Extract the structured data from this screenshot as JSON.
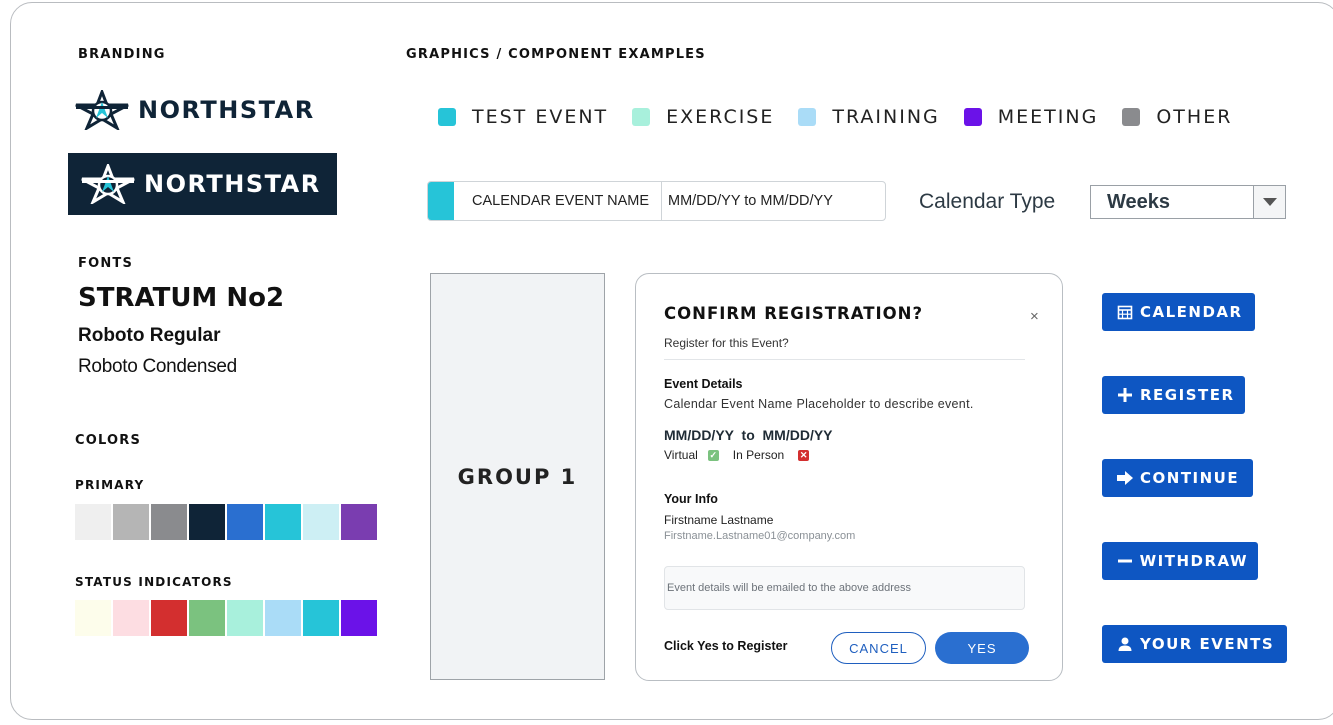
{
  "branding": {
    "heading": "BRANDING",
    "logo_text": "NORTHSTAR",
    "logo_dark_text": "NORTHSTAR"
  },
  "fonts": {
    "heading": "FONTS",
    "stratum": "STRATUM No2",
    "roboto_regular": "Roboto Regular",
    "roboto_condensed": "Roboto Condensed"
  },
  "colors": {
    "heading": "COLORS",
    "primary_label": "PRIMARY",
    "primary": [
      "#efefef",
      "#b5b5b5",
      "#8a8b8e",
      "#0f2437",
      "#2a6fd0",
      "#26c4d8",
      "#cdeff4",
      "#7a3db0"
    ],
    "status_label": "STATUS INDICATORS",
    "status": [
      "#fdfdeb",
      "#fddde2",
      "#d32f2f",
      "#7bc27f",
      "#a8f0dc",
      "#aadcf7",
      "#26c4d8",
      "#6b12e8"
    ]
  },
  "graphics": {
    "heading": "GRAPHICS / COMPONENT EXAMPLES",
    "legend": [
      {
        "label": "TEST EVENT",
        "color": "#26c4d8"
      },
      {
        "label": "EXERCISE",
        "color": "#a8f0dc"
      },
      {
        "label": "TRAINING",
        "color": "#aadcf7"
      },
      {
        "label": "MEETING",
        "color": "#6b12e8"
      },
      {
        "label": "OTHER",
        "color": "#8a8b8e"
      }
    ],
    "event_bar": {
      "name": "CALENDAR EVENT NAME",
      "dates": "MM/DD/YY to MM/DD/YY",
      "accent": "#26c4d8"
    },
    "calendar_type": {
      "label": "Calendar Type",
      "selected": "Weeks"
    },
    "group_label": "GROUP 1"
  },
  "dialog": {
    "title": "CONFIRM REGISTRATION?",
    "close_icon": "×",
    "subtitle": "Register for this Event?",
    "details_heading": "Event Details",
    "details_text": "Calendar Event Name Placeholder to describe event.",
    "dates": "MM/DD/YY  to  MM/DD/YY",
    "virtual_label": "Virtual",
    "in_person_label": "In Person",
    "info_heading": "Your Info",
    "name": "Firstname Lastname",
    "email": "Firstname.Lastname01@company.com",
    "note": "Event details will be emailed to the above address",
    "prompt": "Click Yes to Register",
    "cancel_label": "CANCEL",
    "yes_label": "YES"
  },
  "actions": [
    {
      "label": "CALENDAR",
      "icon": "calendar-icon"
    },
    {
      "label": "REGISTER",
      "icon": "plus-icon"
    },
    {
      "label": "CONTINUE",
      "icon": "arrow-right-icon"
    },
    {
      "label": "WITHDRAW",
      "icon": "minus-icon"
    },
    {
      "label": "YOUR EVENTS",
      "icon": "user-icon"
    }
  ]
}
